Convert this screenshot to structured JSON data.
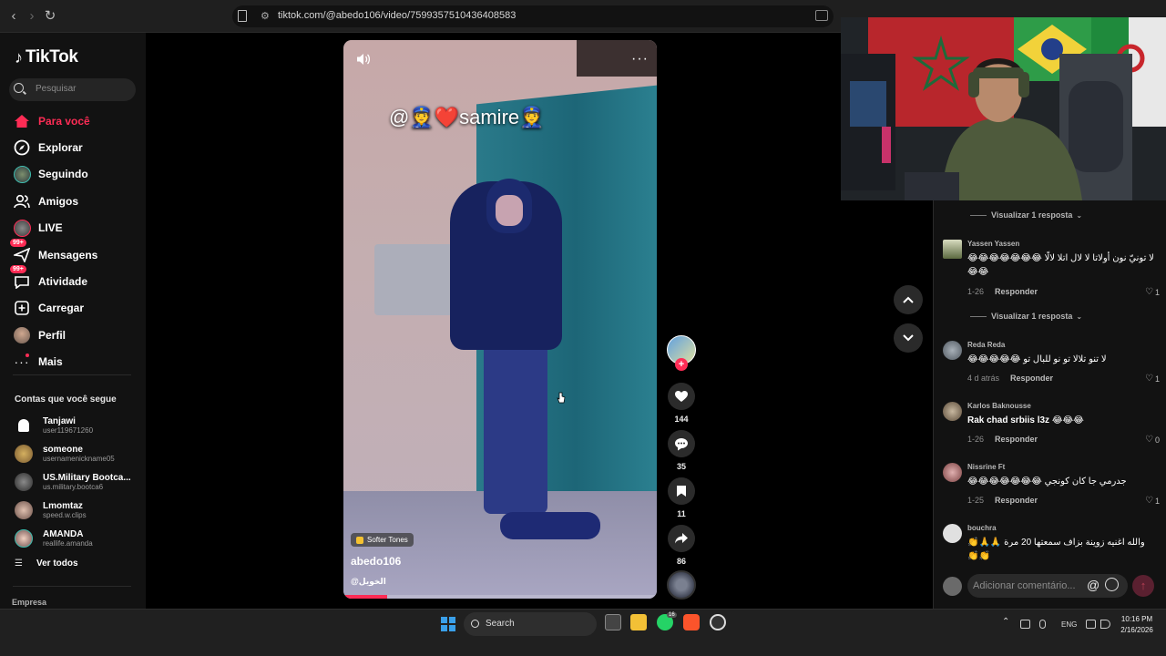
{
  "browser": {
    "url": "tiktok.com/@abedo106/video/7599357510436408583"
  },
  "sidebar": {
    "logo": "TikTok",
    "search_placeholder": "Pesquisar",
    "nav": [
      {
        "label": "Para você",
        "icon": "home-icon",
        "active": true
      },
      {
        "label": "Explorar",
        "icon": "compass-icon"
      },
      {
        "label": "Seguindo",
        "icon": "following-avatar-icon"
      },
      {
        "label": "Amigos",
        "icon": "friends-icon"
      },
      {
        "label": "LIVE",
        "icon": "live-icon"
      },
      {
        "label": "Mensagens",
        "icon": "messages-icon",
        "badge": "99+"
      },
      {
        "label": "Atividade",
        "icon": "activity-icon",
        "badge": "99+"
      },
      {
        "label": "Carregar",
        "icon": "upload-icon"
      },
      {
        "label": "Perfil",
        "icon": "profile-avatar-icon"
      },
      {
        "label": "Mais",
        "icon": "more-icon"
      }
    ],
    "following_title": "Contas que você segue",
    "accounts": [
      {
        "name": "Tanjawi",
        "handle": "user119671260"
      },
      {
        "name": "someone",
        "handle": "usernamenickname05"
      },
      {
        "name": "US.Military Bootca...",
        "handle": "us.military.bootca6"
      },
      {
        "name": "Lmomtaz",
        "handle": "speed.w.clips"
      },
      {
        "name": "AMANDA",
        "handle": "reallife.amanda"
      }
    ],
    "see_all": "Ver todos",
    "company": "Empresa"
  },
  "video": {
    "overlay_text": "@👮❤️samire👮",
    "music": "Softer Tones",
    "author": "abedo106",
    "caption": "@الخويل",
    "progress_fraction": 0.14
  },
  "rail": {
    "likes": "144",
    "comments": "35",
    "saves": "11",
    "shares": "86"
  },
  "comments": {
    "view_replies_1": "Visualizar 1 resposta",
    "view_replies_2": "Visualizar 1 resposta",
    "list": [
      {
        "user": "Yassen Yassen",
        "text": "لا تونيّ نون أولاتا لا لال اتلا لالًا 😂😂😂😂😂😂😂😂😂",
        "date": "1-26",
        "reply": "Responder",
        "likes": "1"
      },
      {
        "user": "Reda Reda",
        "text": "لا تنو تلالا تو نو للبال تو 😂😂😂😂😂",
        "date": "4 d atrás",
        "reply": "Responder",
        "likes": "1"
      },
      {
        "user": "Karlos Baknousse",
        "text": "Rak chad srbiis l3z 😂😂😂",
        "date": "1-26",
        "reply": "Responder",
        "likes": "0"
      },
      {
        "user": "Nissrine Ft",
        "text": "جدرمي جا كان كونجي 😂😂😂😂😂😂😂",
        "date": "1-25",
        "reply": "Responder",
        "likes": "1"
      },
      {
        "user": "bouchra",
        "text": "والله اغنيه زوينة بزاف سمعتها 20 مرة 🙏🙏👏👏👏"
      }
    ],
    "input_placeholder": "Adicionar comentário...",
    "at_symbol": "@"
  },
  "taskbar": {
    "search_label": "Search",
    "whatsapp_badge": "16",
    "lang": "ENG",
    "time": "10:16 PM",
    "date": "2/16/2026"
  },
  "colors": {
    "accent": "#fe2c55",
    "background": "#121212",
    "windows_blue": "#3aa0ea"
  }
}
